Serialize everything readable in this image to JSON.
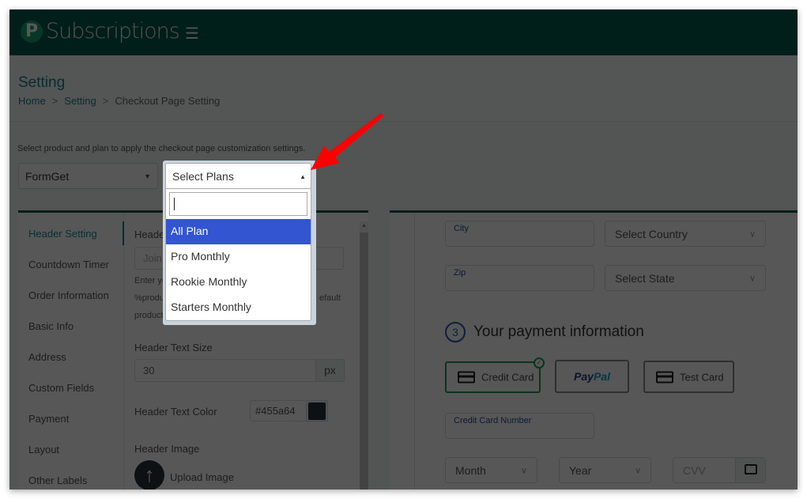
{
  "app": {
    "brand": "Subscriptions",
    "logo_letter": "P",
    "menu_icon": "hamburger-icon"
  },
  "page": {
    "title": "Setting",
    "breadcrumb": [
      "Home",
      "Setting",
      "Checkout Page Setting"
    ],
    "breadcrumb_sep": ">"
  },
  "selector": {
    "hint": "Select product and plan to apply the checkout page customization settings.",
    "product_value": "FormGet",
    "plans_value": "Select Plans",
    "plans_search_value": "",
    "plans_options": [
      "All Plan",
      "Pro Monthly",
      "Rookie Monthly",
      "Starters Monthly"
    ],
    "plans_highlighted": "All Plan"
  },
  "left_nav": {
    "active": "Header Setting",
    "items": [
      "Header Setting",
      "Countdown Timer",
      "Order Information",
      "Basic Info",
      "Address",
      "Custom Fields",
      "Payment",
      "Layout",
      "Other Labels"
    ]
  },
  "header_form": {
    "header_label": "Header",
    "header_placeholder": "Join %",
    "desc_line1": "Enter yo",
    "desc_line2": "%produ",
    "desc_line2_end": "efault",
    "desc_line3": "product",
    "text_size_label": "Header Text Size",
    "text_size_value": "30",
    "text_size_unit": "px",
    "text_color_label": "Header Text Color",
    "text_color_value": "#455a64",
    "image_label": "Header Image",
    "upload_label": "Upload Image"
  },
  "preview": {
    "city_label": "City",
    "country_placeholder": "Select Country",
    "zip_label": "Zip",
    "state_placeholder": "Select State",
    "step_number": "3",
    "step_title": "Your payment information",
    "payment_methods": [
      {
        "label": "Credit Card",
        "selected": true
      },
      {
        "label": "PayPal",
        "selected": false
      },
      {
        "label": "Test Card",
        "selected": false
      }
    ],
    "paypal_part1": "Pay",
    "paypal_part2": "Pal",
    "card_number_label": "Credit Card Number",
    "month_placeholder": "Month",
    "year_placeholder": "Year",
    "cvv_placeholder": "CVV"
  },
  "colors": {
    "topbar": "#005a4c",
    "accent": "#1f7f8a",
    "highlight": "#3355d1",
    "annotation_arrow": "#ff0000"
  }
}
